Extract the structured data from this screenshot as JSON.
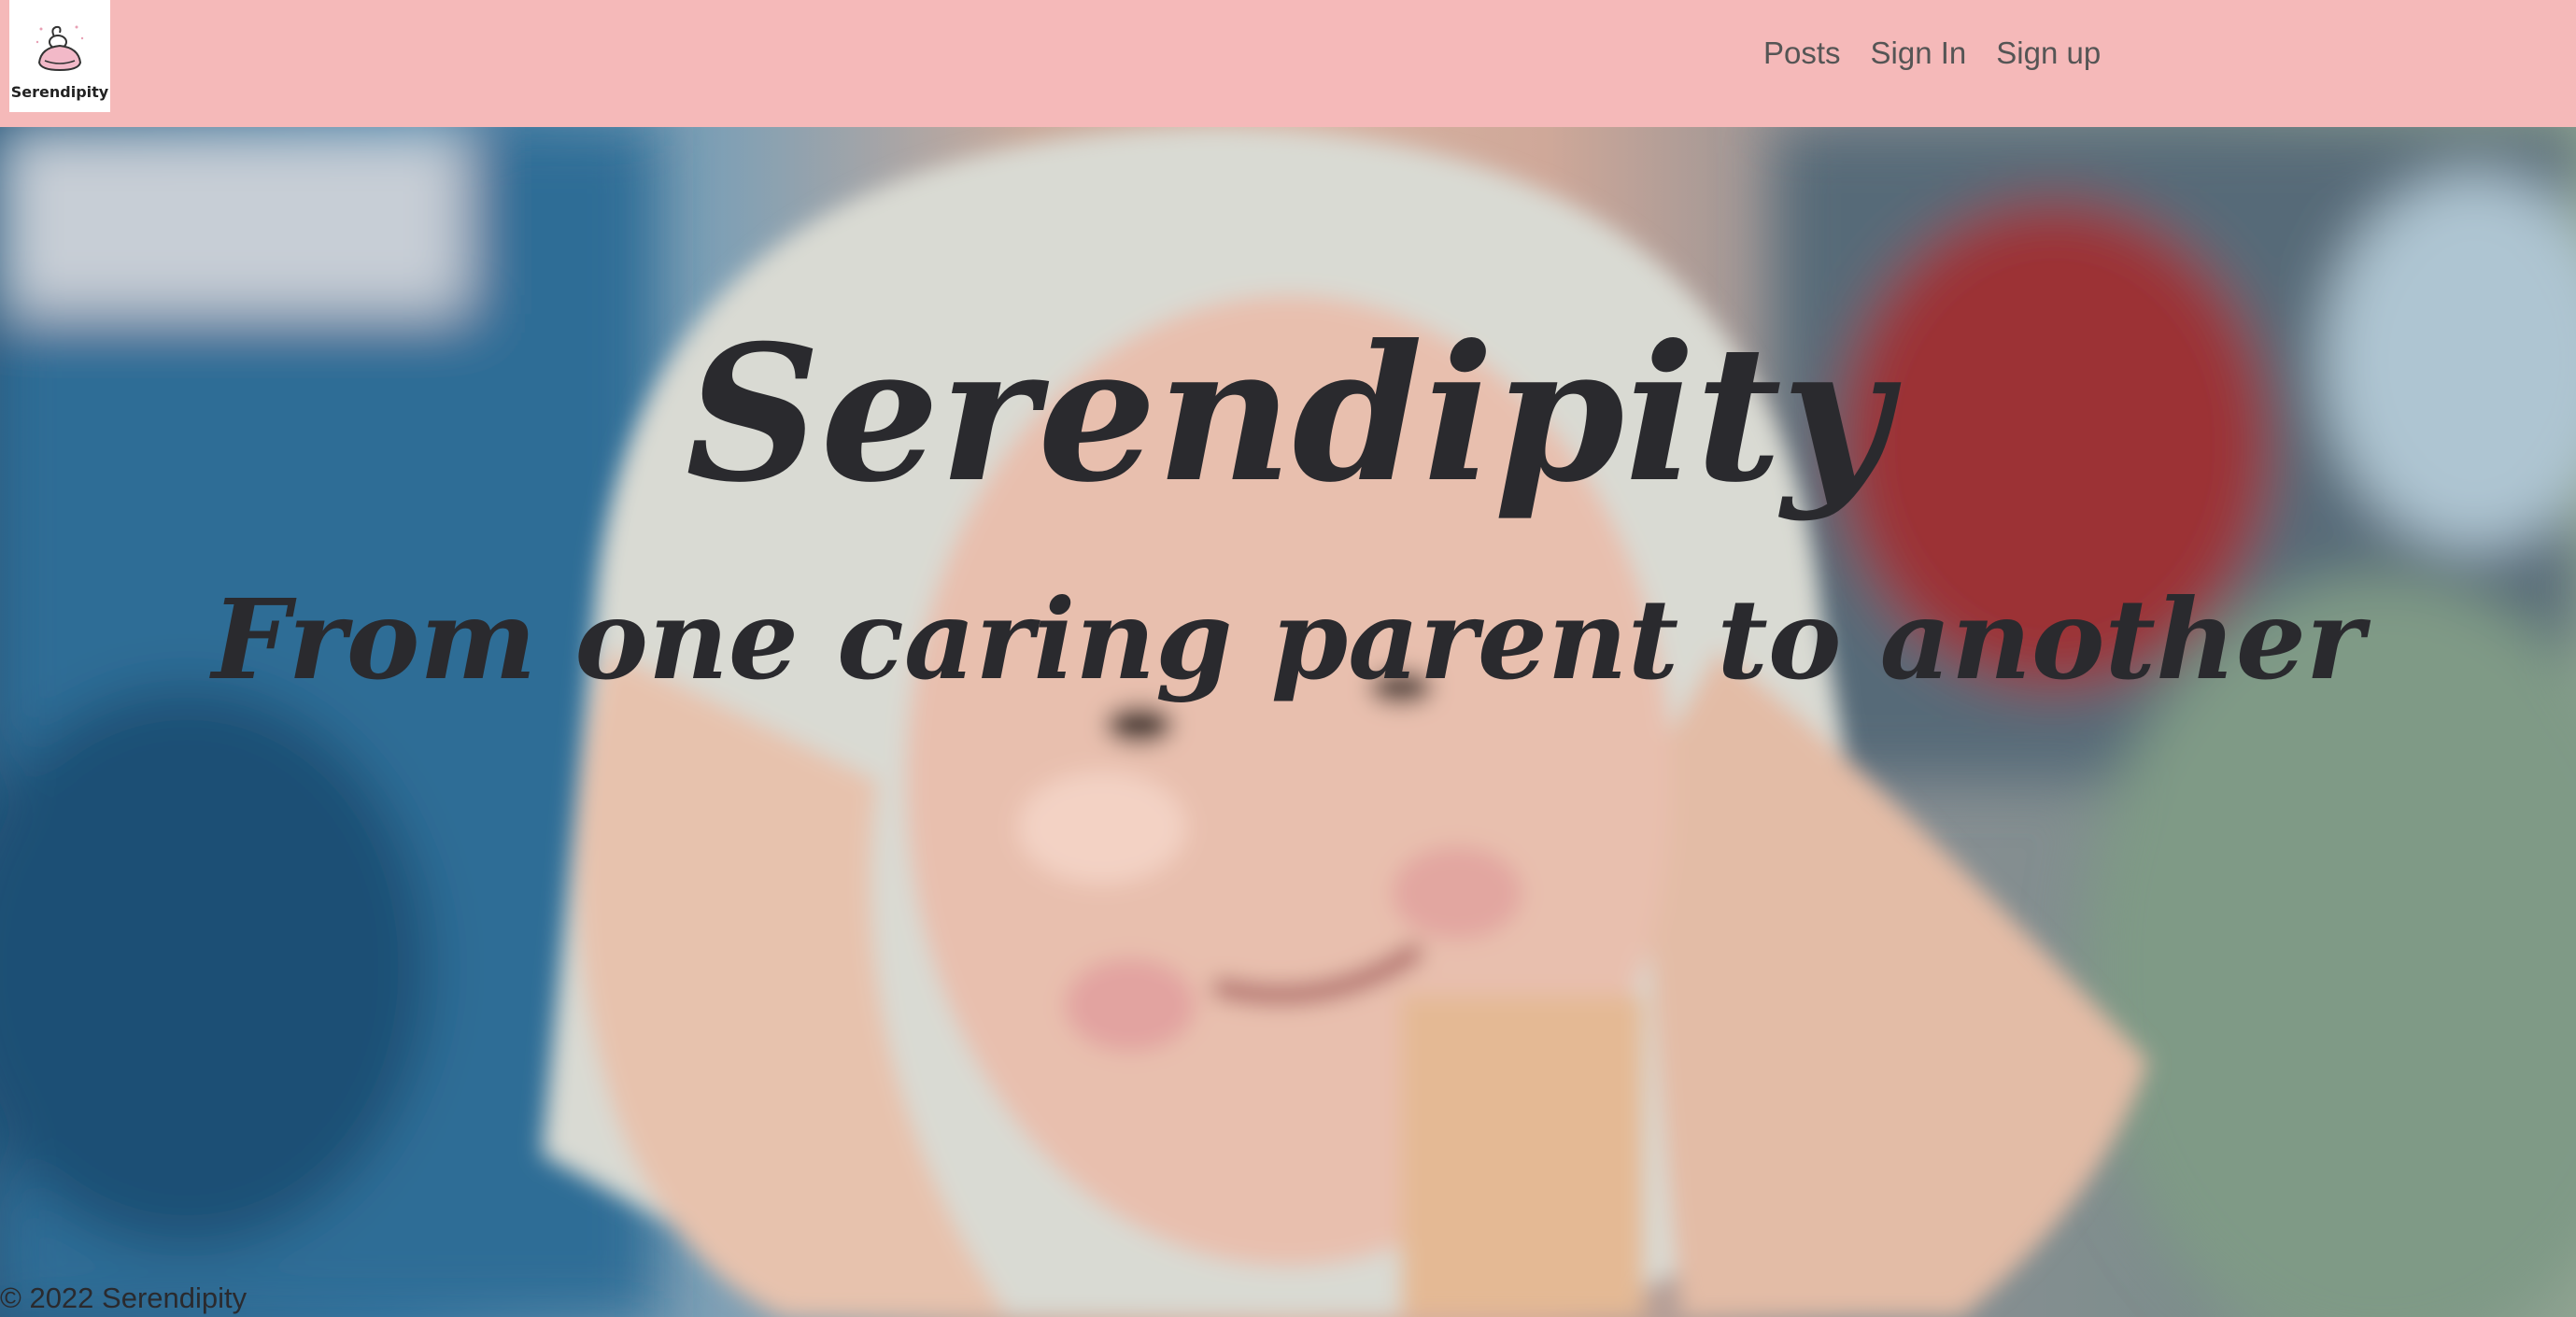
{
  "header": {
    "logo_text": "Serendipity",
    "background_color": "#f5b9b9",
    "nav": [
      {
        "label": "Posts"
      },
      {
        "label": "Sign In"
      },
      {
        "label": "Sign up"
      }
    ]
  },
  "hero": {
    "title": "Serendipity",
    "subtitle": "From one caring parent to another",
    "background_image": "baby wrapped in towel held by parent's hands"
  },
  "footer": {
    "copyright": "© 2022 Serendipity"
  }
}
